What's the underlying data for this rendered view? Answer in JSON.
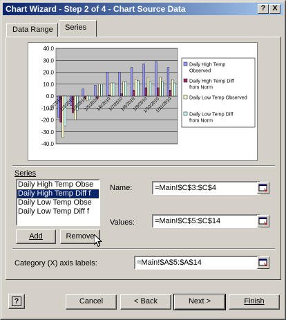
{
  "window": {
    "title": "Chart Wizard - Step 2 of 4 - Chart Source Data",
    "help_glyph": "?",
    "close_glyph": "X"
  },
  "tabs": [
    {
      "label": "Data Range",
      "active": false
    },
    {
      "label": "Series",
      "active": true
    }
  ],
  "chart_data": {
    "type": "bar",
    "ylim": [
      -40,
      40
    ],
    "y_ticks": [
      "40.0",
      "30.0",
      "20.0",
      "10.0",
      "0.0",
      "-10.0",
      "-20.0",
      "-30.0",
      "-40.0"
    ],
    "categories": [
      "1/2/2010",
      "1/3/2010",
      "1/4/2010",
      "1/5/2010",
      "1/6/2010",
      "1/7/2010",
      "1/8/2010",
      "1/9/2010",
      "1/10/2010",
      "1/11/2010"
    ],
    "x_tick_labels": [
      "1/2/2010",
      "1/3/2010",
      "1/4/2010",
      "1/5/2010",
      "1/6/2010",
      "1/7/2010",
      "1/8/2010",
      "1/9/2010",
      "1/10/2010",
      "1/11/2010"
    ],
    "series": [
      {
        "name": "Daily High Temp Observed",
        "color": "#9999ff",
        "values": [
          -18,
          -8,
          6,
          9,
          20,
          20,
          24,
          27,
          29,
          24
        ]
      },
      {
        "name": "Daily High Temp Diff from Norm",
        "color": "#993366",
        "values": [
          -22,
          -14,
          -2,
          -2,
          1,
          2,
          5,
          7,
          7,
          5
        ]
      },
      {
        "name": "Daily Low Temp Observed",
        "color": "#ffffcc",
        "values": [
          -35,
          -20,
          -4,
          10,
          11,
          12,
          14,
          16,
          16,
          14
        ]
      },
      {
        "name": "Daily Low Temp Diff from Norm",
        "color": "#ccffff",
        "values": [
          -25,
          -12,
          -3,
          10,
          11,
          12,
          13,
          12,
          12,
          11
        ]
      }
    ],
    "legend_position": "right",
    "plot_background": "#c0c0c0",
    "grid": true
  },
  "series_section": {
    "label": "Series",
    "items": [
      {
        "label": "Daily High Temp Obse",
        "selected": false
      },
      {
        "label": "Daily High Temp Diff f",
        "selected": true
      },
      {
        "label": "Daily Low Temp Obse",
        "selected": false
      },
      {
        "label": "Daily Low Temp Diff f",
        "selected": false
      }
    ],
    "add_label": "Add",
    "remove_label": "Remove"
  },
  "name_field": {
    "label": "Name:",
    "value": "=Main!$C$3:$C$4"
  },
  "values_field": {
    "label": "Values:",
    "value": "=Main!$C$5:$C$14"
  },
  "category_field": {
    "label": "Category (X) axis labels:",
    "value": "=Main!$A$5:$A$14"
  },
  "footer": {
    "help_glyph": "?",
    "cancel_label": "Cancel",
    "back_label": "< Back",
    "next_label": "Next >",
    "finish_label": "Finish"
  }
}
